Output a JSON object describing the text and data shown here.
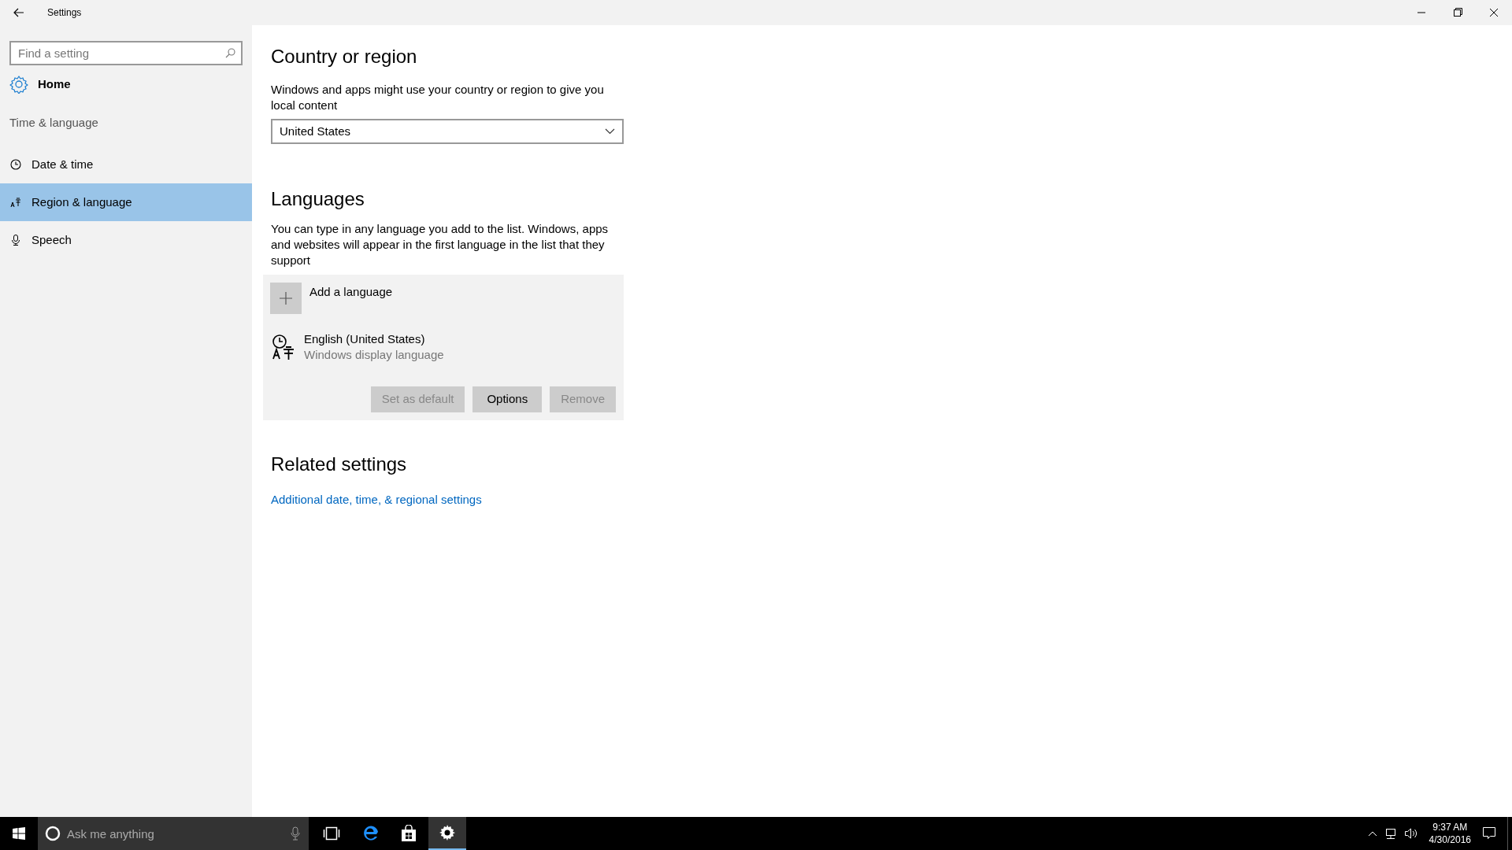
{
  "window": {
    "title": "Settings"
  },
  "sidebar": {
    "search": {
      "placeholder": "Find a setting"
    },
    "home": "Home",
    "section": "Time & language",
    "items": [
      {
        "label": "Date & time",
        "kind": "clock",
        "selected": false
      },
      {
        "label": "Region & language",
        "kind": "language",
        "selected": true
      },
      {
        "label": "Speech",
        "kind": "microphone",
        "selected": false
      }
    ]
  },
  "country": {
    "heading": "Country or region",
    "description": "Windows and apps might use your country or region to give you local content",
    "value": "United States"
  },
  "languages": {
    "heading": "Languages",
    "description": "You can type in any language you add to the list. Windows, apps and websites will appear in the first language in the list that they support",
    "add_label": "Add a language",
    "items": [
      {
        "name": "English (United States)",
        "detail": "Windows display language"
      }
    ],
    "buttons": [
      {
        "label": "Set as default",
        "disabled": true
      },
      {
        "label": "Options",
        "disabled": false
      },
      {
        "label": "Remove",
        "disabled": true
      }
    ]
  },
  "related": {
    "heading": "Related settings",
    "links": [
      "Additional date, time, & regional settings"
    ]
  },
  "taskbar": {
    "search_placeholder": "Ask me anything",
    "apps": [
      {
        "kind": "task-view",
        "active": false
      },
      {
        "kind": "browser",
        "active": false
      },
      {
        "kind": "store",
        "active": false
      },
      {
        "kind": "settings",
        "active": true
      }
    ],
    "time": "9:37 AM",
    "date": "4/30/2016"
  }
}
